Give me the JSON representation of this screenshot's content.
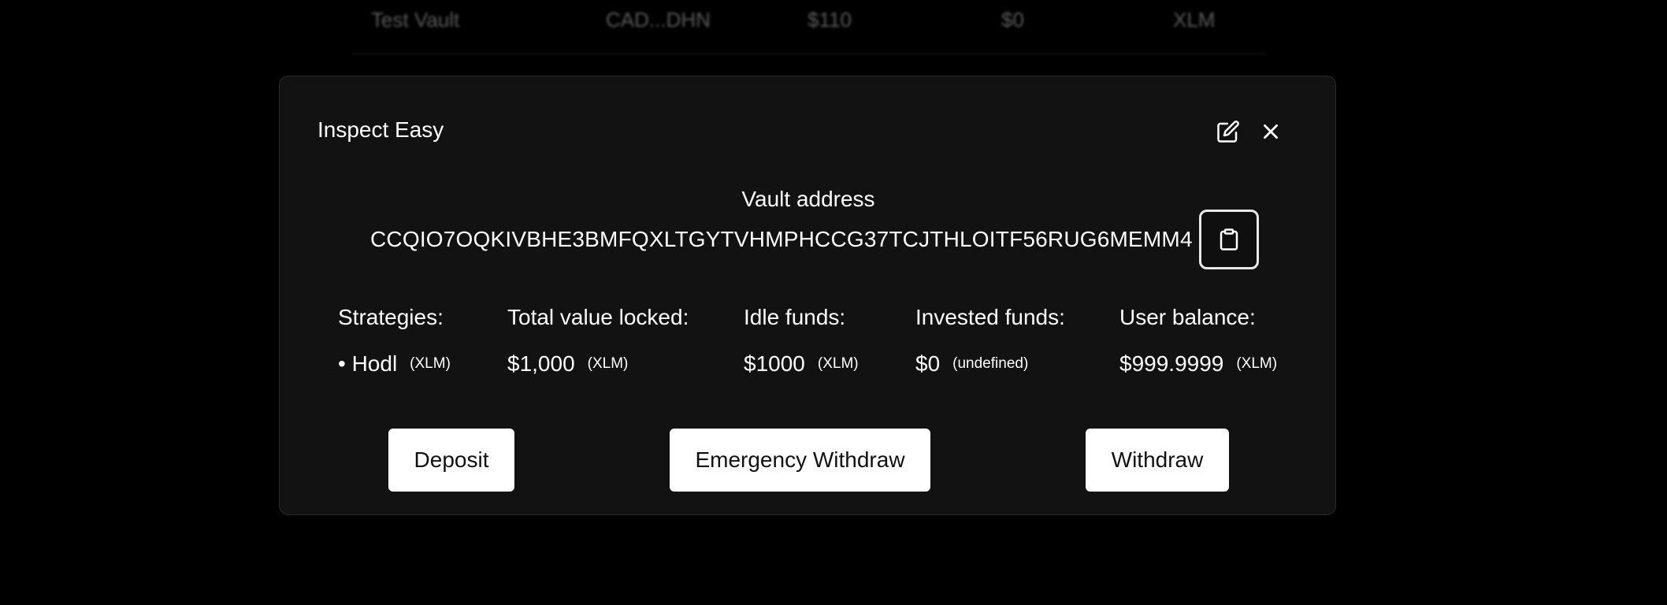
{
  "background_table": {
    "row": {
      "name": "Test Vault",
      "address": "CAD...DHN",
      "tvl": "$110",
      "balance": "$0",
      "asset": "XLM"
    }
  },
  "modal": {
    "title": "Inspect Easy",
    "edit_icon": "edit-icon",
    "close_icon": "close-icon",
    "vault_address_label": "Vault address",
    "vault_address": "CCQIO7OQKIVBHE3BMFQXLTGYTVHMPHCCG37TCJTHLOITF56RUG6MEMM4",
    "copy_icon": "clipboard-icon",
    "stats": {
      "strategies": {
        "label": "Strategies:",
        "value": "• Hodl",
        "unit": "(XLM)"
      },
      "tvl": {
        "label": "Total value locked:",
        "value": "$1,000",
        "unit": "(XLM)"
      },
      "idle": {
        "label": "Idle funds:",
        "value": "$1000",
        "unit": "(XLM)"
      },
      "invested": {
        "label": "Invested funds:",
        "value": "$0",
        "unit": "(undefined)"
      },
      "user_balance": {
        "label": "User balance:",
        "value": "$999.9999",
        "unit": "(XLM)"
      }
    },
    "buttons": {
      "deposit": "Deposit",
      "emergency_withdraw": "Emergency Withdraw",
      "withdraw": "Withdraw"
    }
  },
  "colors": {
    "background": "#000000",
    "modal_bg": "#121212",
    "button_bg": "#ffffff",
    "button_text": "#111111"
  }
}
